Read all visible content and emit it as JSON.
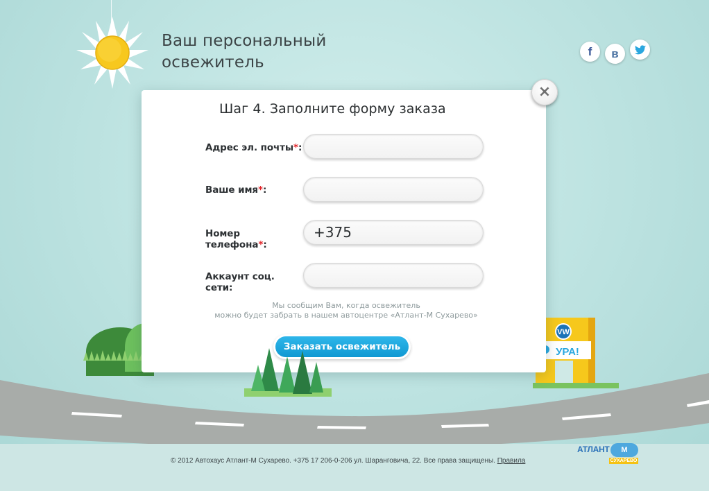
{
  "header": {
    "title_line1": "Ваш персональный",
    "title_line2": "освежитель"
  },
  "social": [
    {
      "label": "f",
      "icon": "facebook-icon"
    },
    {
      "label": "в",
      "icon": "vkontakte-icon"
    },
    {
      "label": "t",
      "icon": "twitter-icon"
    }
  ],
  "modal": {
    "close_label": "×",
    "title": "Шаг 4. Заполните форму заказа",
    "fields": [
      {
        "label": "Адрес эл. почты",
        "required_mark": "*",
        "suffix": ":",
        "value": "",
        "placeholder": ""
      },
      {
        "label": "Ваше имя",
        "required_mark": "*",
        "suffix": ":",
        "value": "",
        "placeholder": ""
      },
      {
        "label": "Номер телефона",
        "required_mark": "*",
        "suffix": ":",
        "value": "+375",
        "placeholder": ""
      },
      {
        "label": "Аккаунт соц. сети",
        "required_mark": "",
        "suffix": ":",
        "value": "",
        "placeholder": ""
      }
    ],
    "note_line1": "Мы сообщим Вам, когда освежитель",
    "note_line2": "можно будет забрать в нашем автоцентре «Атлант-М Сухарево»",
    "order_button": "Заказать освежитель"
  },
  "scenery": {
    "arch_sign": "УРА!",
    "arch_logo": "vw-logo-icon"
  },
  "footer": {
    "text": "© 2012 Автохаус Атлант-М Сухарево. +375 17 206-0-206 ул. Шаранговича, 22. Все права защищены.",
    "link": "Правила"
  },
  "brand": {
    "name": "АТЛАНТ",
    "mark": "М",
    "sub": "СУХАРЕВО"
  },
  "colors": {
    "background": "#bfe4e2",
    "button": "#1ba6de",
    "required": "#e2262b",
    "sun": "#f7c81e"
  }
}
